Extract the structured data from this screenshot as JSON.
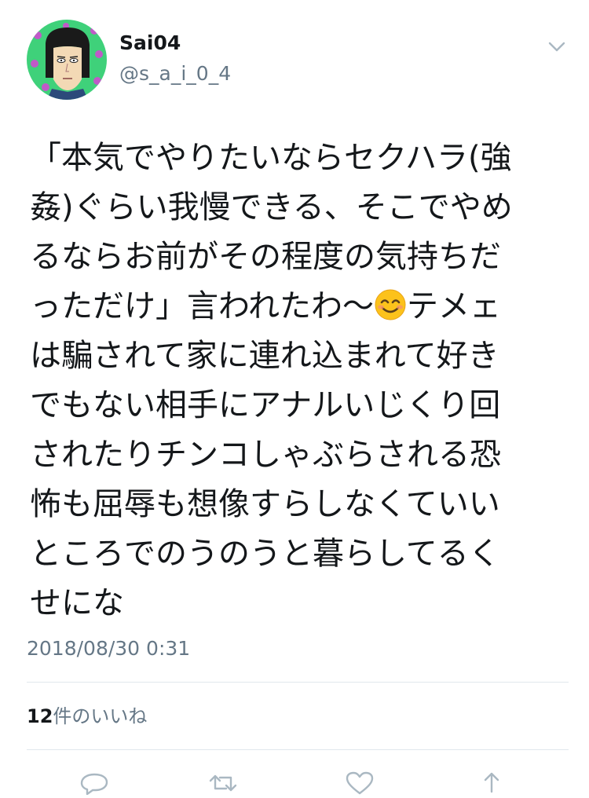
{
  "tweet": {
    "display_name": "Sai04",
    "handle": "@s_a_i_0_4",
    "text_lines": [
      "「本気でやりたいならセクハラ(強",
      "姦)ぐらい我慢できる、そこでやめ",
      "るならお前がその程度の気持ちだ",
      "っただけ」言われたわ〜",
      "は騙されて家に連れ込まれて好き",
      "でもない相手にアナルいじくり回",
      "されたりチンコしゃぶらされる恐",
      "怖も屈辱も想像すらしなくていい",
      "ところでのうのうと暮らしてるく",
      "せにな"
    ],
    "text_line4_after_emoji": "テメェ",
    "emoji": "smiling-face-emoji",
    "timestamp": "2018/08/30 0:31",
    "likes_count": "12",
    "likes_label": "件のいいね"
  },
  "icons": {
    "menu": "chevron-down-icon",
    "reply": "reply-icon",
    "retweet": "retweet-icon",
    "like": "heart-icon",
    "share": "share-icon"
  },
  "colors": {
    "text": "#14171a",
    "secondary": "#657786",
    "divider": "#e1e8ed",
    "avatar_bg": "#3fd17a",
    "avatar_dots": "#c05ac8"
  }
}
